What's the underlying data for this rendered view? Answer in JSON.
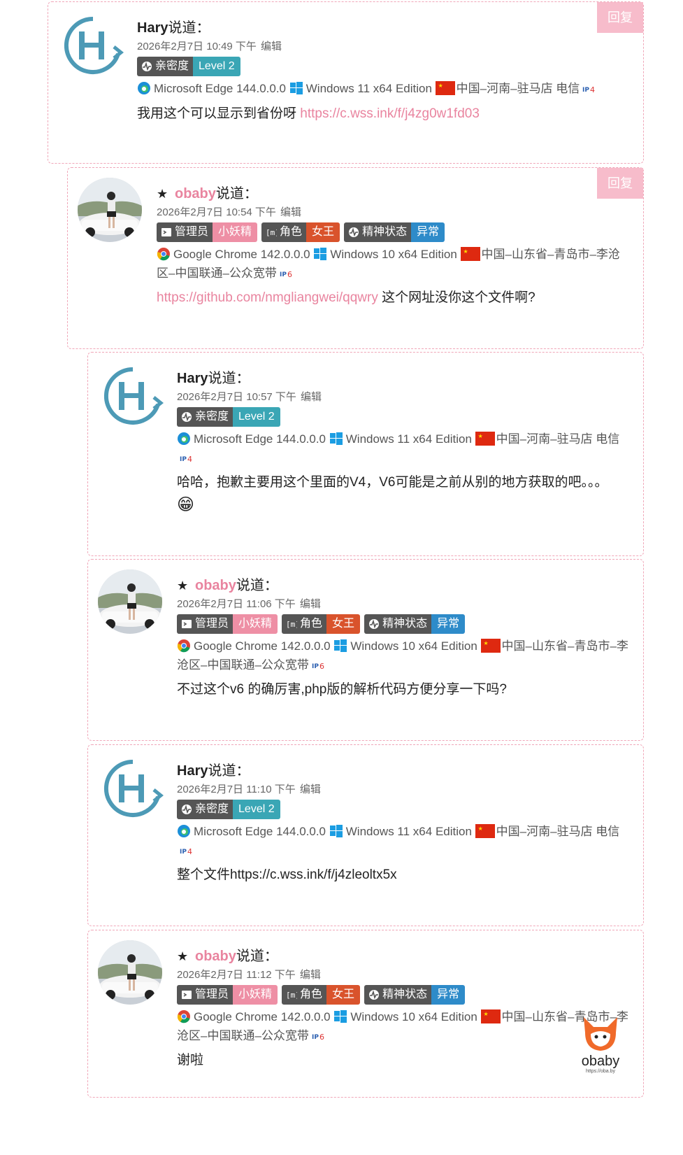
{
  "reply_label": "回复",
  "said_suffix": "说道：",
  "edit_label": "编辑",
  "comments": [
    {
      "author": "Hary",
      "datetime": "2026年2月7日 10:49 下午",
      "badges": [
        {
          "key": "亲密度",
          "value": "Level 2",
          "color": "teal",
          "icon": "heartbeat-icon"
        }
      ],
      "browser": "Microsoft Edge 144.0.0.0",
      "os": "Windows 11 x64 Edition",
      "location": "中国–河南–驻马店 电信",
      "ip_version": "IPv4",
      "text": "我用这个可以显示到省份呀 ",
      "link": "https://c.wss.ink/f/j4zg0w1fd03",
      "text_after": ""
    },
    {
      "author": "obaby",
      "datetime": "2026年2月7日 10:54 下午",
      "badges": [
        {
          "key": "管理员",
          "value": "小妖精",
          "color": "pink",
          "icon": "terminal-icon"
        },
        {
          "key": "角色",
          "value": "女王",
          "color": "red",
          "icon": "bracket-m-icon"
        },
        {
          "key": "精神状态",
          "value": "异常",
          "color": "blue",
          "icon": "heartbeat-icon"
        }
      ],
      "browser": "Google Chrome 142.0.0.0",
      "os": "Windows 10 x64 Edition",
      "location": "中国–山东省–青岛市–李沧区–中国联通–公众宽带",
      "ip_version": "IPv6",
      "text": "",
      "link": "https://github.com/nmgliangwei/qqwry",
      "text_after": " 这个网址没你这个文件啊?"
    },
    {
      "author": "Hary",
      "datetime": "2026年2月7日 10:57 下午",
      "badges": [
        {
          "key": "亲密度",
          "value": "Level 2",
          "color": "teal",
          "icon": "heartbeat-icon"
        }
      ],
      "browser": "Microsoft Edge 144.0.0.0",
      "os": "Windows 11 x64 Edition",
      "location": "中国–河南–驻马店 电信",
      "ip_version": "IPv4",
      "text": "哈哈，抱歉主要用这个里面的V4，V6可能是之前从别的地方获取的吧。。。",
      "link": "",
      "text_after": "",
      "emoji": "😁"
    },
    {
      "author": "obaby",
      "datetime": "2026年2月7日 11:06 下午",
      "badges": [
        {
          "key": "管理员",
          "value": "小妖精",
          "color": "pink",
          "icon": "terminal-icon"
        },
        {
          "key": "角色",
          "value": "女王",
          "color": "red",
          "icon": "bracket-m-icon"
        },
        {
          "key": "精神状态",
          "value": "异常",
          "color": "blue",
          "icon": "heartbeat-icon"
        }
      ],
      "browser": "Google Chrome 142.0.0.0",
      "os": "Windows 10 x64 Edition",
      "location": "中国–山东省–青岛市–李沧区–中国联通–公众宽带",
      "ip_version": "IPv6",
      "text": "不过这个v6 的确厉害,php版的解析代码方便分享一下吗?",
      "link": "",
      "text_after": ""
    },
    {
      "author": "Hary",
      "datetime": "2026年2月7日 11:10 下午",
      "badges": [
        {
          "key": "亲密度",
          "value": "Level 2",
          "color": "teal",
          "icon": "heartbeat-icon"
        }
      ],
      "browser": "Microsoft Edge 144.0.0.0",
      "os": "Windows 11 x64 Edition",
      "location": "中国–河南–驻马店 电信",
      "ip_version": "IPv4",
      "text": "整个文件https://c.wss.ink/f/j4zleoltx5x",
      "link": "",
      "text_after": ""
    },
    {
      "author": "obaby",
      "datetime": "2026年2月7日 11:12 下午",
      "badges": [
        {
          "key": "管理员",
          "value": "小妖精",
          "color": "pink",
          "icon": "terminal-icon"
        },
        {
          "key": "角色",
          "value": "女王",
          "color": "red",
          "icon": "bracket-m-icon"
        },
        {
          "key": "精神状态",
          "value": "异常",
          "color": "blue",
          "icon": "heartbeat-icon"
        }
      ],
      "browser": "Google Chrome 142.0.0.0",
      "os": "Windows 10 x64 Edition",
      "location": "中国–山东省–青岛市–李沧区–中国联通–公众宽带",
      "ip_version": "IPv6",
      "text": "谢啦",
      "link": "",
      "text_after": ""
    }
  ],
  "floating_logo": {
    "text": "obaby",
    "sub": "https://oba.by"
  },
  "colors": {
    "accent_pink": "#e9849f",
    "reply_bg": "#f7bccb",
    "border": "#f0a6b8"
  }
}
